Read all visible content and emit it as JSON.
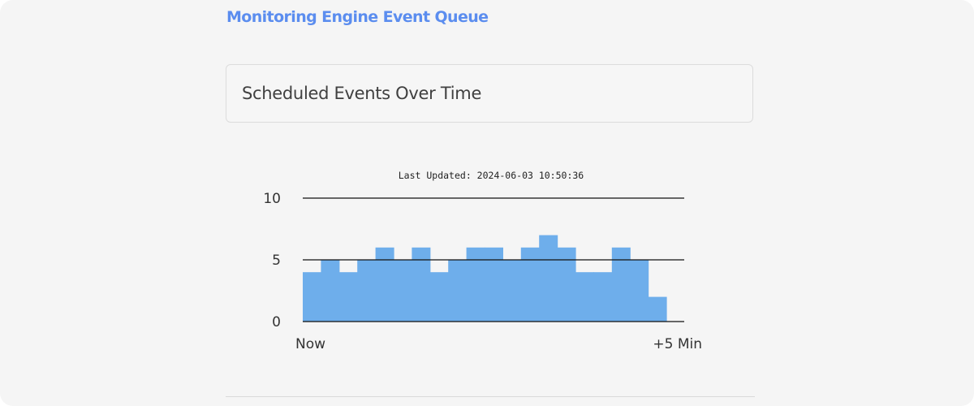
{
  "header": {
    "title": "Monitoring Engine Event Queue"
  },
  "panel": {
    "title": "Scheduled Events Over Time"
  },
  "colors": {
    "title_accent": "#5b8def",
    "bar_fill": "#6eaeeb",
    "grid_line": "#111111",
    "background": "#f5f5f5"
  },
  "chart_data": {
    "type": "area",
    "subtitle": "Last Updated: 2024-06-03 10:50:36",
    "x_labels": [
      "Now",
      "+5 Min"
    ],
    "y_ticks": [
      0,
      5,
      10
    ],
    "ylim": [
      0,
      10
    ],
    "grid": "horizontal",
    "values": [
      4,
      5,
      4,
      5,
      6,
      5,
      6,
      4,
      5,
      6,
      6,
      5,
      6,
      7,
      6,
      4,
      4,
      6,
      5,
      2
    ]
  }
}
